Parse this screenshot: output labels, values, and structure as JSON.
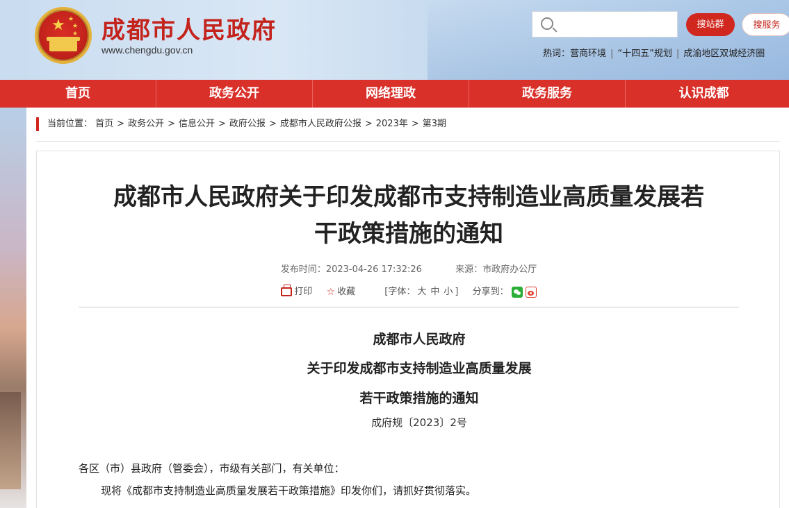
{
  "header": {
    "site_title": "成都市人民政府",
    "site_domain": "www.chengdu.gov.cn",
    "search": {
      "placeholder": ""
    },
    "search_site_label": "搜站群",
    "search_service_label": "搜服务",
    "hot_label": "热词：",
    "hot_words": [
      "营商环境",
      "“十四五”规划",
      "成渝地区双城经济圈"
    ],
    "hot_sep": "|"
  },
  "nav": {
    "items": [
      "首页",
      "政务公开",
      "网络理政",
      "政务服务",
      "认识成都"
    ]
  },
  "breadcrumb": {
    "label": "当前位置：",
    "items": [
      "首页",
      "政务公开",
      "信息公开",
      "政府公报",
      "成都市人民政府公报",
      "2023年",
      "第3期"
    ],
    "sep": ">"
  },
  "article": {
    "title": "成都市人民政府关于印发成都市支持制造业高质量发展若干政策措施的通知",
    "publish_time_label": "发布时间：",
    "publish_time": "2023-04-26 17:32:26",
    "source_label": "来源：",
    "source": "市政府办公厅",
    "tools": {
      "print": "打印",
      "favorite": "收藏",
      "font_open": "[字体：",
      "font_large": "大",
      "font_medium": "中",
      "font_small": "小",
      "font_close": "]",
      "share": "分享到："
    },
    "doc_issuer": "成都市人民政府",
    "doc_title_line1": "关于印发成都市支持制造业高质量发展",
    "doc_title_line2": "若干政策措施的通知",
    "doc_number": "成府规〔2023〕2号",
    "salutation": "各区（市）县政府（管委会），市级有关部门，有关单位：",
    "body_line1": "现将《成都市支持制造业高质量发展若干政策措施》印发你们，请抓好贯彻落实。"
  },
  "colors": {
    "brand_red": "#d0271f",
    "nav_red": "#d9302a",
    "emblem_gold": "#f2c94c"
  }
}
